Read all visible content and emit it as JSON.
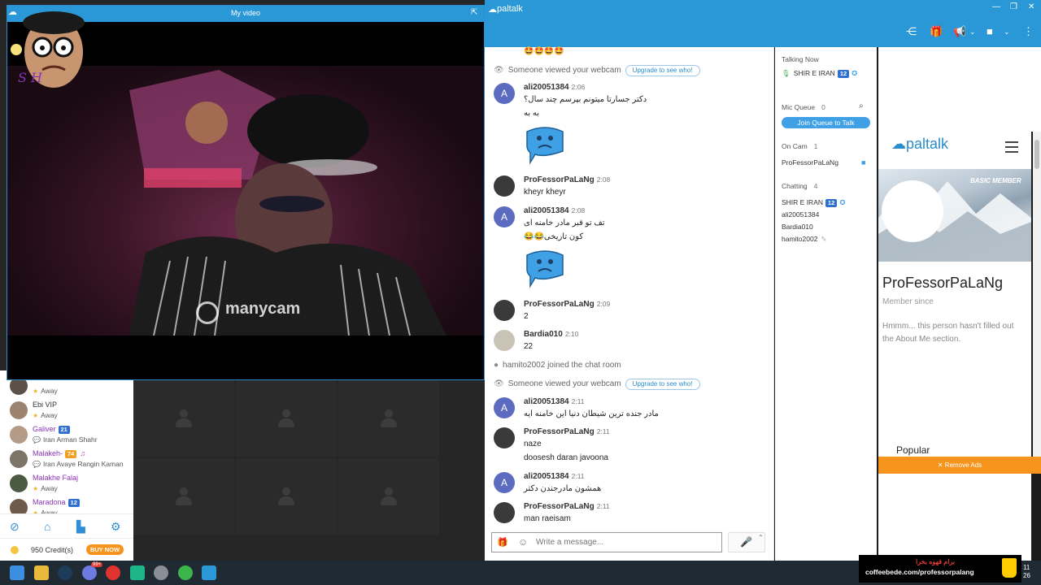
{
  "video_window": {
    "title": "My video",
    "overlay_logo": "manycam"
  },
  "app": {
    "name": "paltalk"
  },
  "friends": [
    {
      "name": "",
      "status": "Away",
      "status_kind": "away"
    },
    {
      "name": "Ebi VIP",
      "status": "Away",
      "status_kind": "away"
    },
    {
      "name": "Galiver",
      "badge": "21",
      "status": "Iran Arman Shahr",
      "status_kind": "room"
    },
    {
      "name": "Malakeh-",
      "badge": "74",
      "status": "Iran Avaye Rangin Kaman",
      "status_kind": "room"
    },
    {
      "name": "Malakhe Falaj",
      "status": "Away",
      "status_kind": "away"
    },
    {
      "name": "Maradona",
      "badge": "12",
      "status": "Away",
      "status_kind": "away"
    }
  ],
  "credits": {
    "text": "950 Credit(s)",
    "buy_label": "BUY NOW"
  },
  "chat": {
    "top_emojis": "🤩🤩🤩🤩",
    "upgrade_label": "Upgrade to see who!",
    "system_webcam": "Someone viewed your webcam",
    "system_join": "hamito2002 joined the chat room",
    "messages": [
      {
        "user": "ali20051384",
        "time": "2:06",
        "lines": [
          "دکتر جسارتا میتونم بپرسم چند سال؟",
          "به به"
        ]
      },
      {
        "user": "ProFessorPaLaNg",
        "time": "2:08",
        "lines": [
          "kheyr kheyr"
        ]
      },
      {
        "user": "ali20051384",
        "time": "2:08",
        "lines": [
          "تف تو قبر مادر خامنه ای",
          "کون تاریخی😂😂"
        ]
      },
      {
        "user": "ProFessorPaLaNg",
        "time": "2:09",
        "lines": [
          "2"
        ]
      },
      {
        "user": "Bardia010",
        "time": "2:10",
        "lines": [
          "22"
        ]
      },
      {
        "user": "ali20051384",
        "time": "2:11",
        "lines": [
          "مادر جنده ترین شیطان دنیا این خامنه ایه"
        ]
      },
      {
        "user": "ProFessorPaLaNg",
        "time": "2:11",
        "lines": [
          "naze",
          "doosesh daran javoona"
        ]
      },
      {
        "user": "ali20051384",
        "time": "2:11",
        "lines": [
          "همشون مادرجندن دکتر"
        ]
      },
      {
        "user": "ProFessorPaLaNg",
        "time": "2:11",
        "lines": [
          "man raeisam"
        ]
      }
    ],
    "composer_placeholder": "Write a message..."
  },
  "side_panel": {
    "talking_now_label": "Talking Now",
    "talking_user": "SHIR E IRAN",
    "talking_badge": "12",
    "mic_queue_label": "Mic Queue",
    "mic_queue_count": "0",
    "join_queue_label": "Join Queue to Talk",
    "on_cam_label": "On Cam",
    "on_cam_count": "1",
    "on_cam_user": "ProFessorPaLaNg",
    "chatting_label": "Chatting",
    "chatting_count": "4",
    "chatting_users": [
      {
        "name": "SHIR E IRAN",
        "badge": "12"
      },
      {
        "name": "ali20051384"
      },
      {
        "name": "Bardia010"
      },
      {
        "name": "hamito2002"
      }
    ]
  },
  "profile": {
    "logo": "paltalk",
    "member_type": "BASIC MEMBER",
    "name": "ProFessorPaLaNg",
    "member_since": "Member since",
    "about": "Hmmm... this person hasn't filled out the About Me section.",
    "popular_label": "Popular",
    "remove_ads": "✕ Remove Ads"
  },
  "coffee_banner": {
    "headline": "برام قهوه بخرا",
    "url": "coffeebede.com/professorpalang"
  },
  "taskbar": {
    "clock_top": "11",
    "clock_bottom": "26",
    "badge": "99+"
  },
  "colors": {
    "brand_blue": "#2a98d7",
    "accent_orange": "#f7941d",
    "avatar_indigo": "#5c6bc0"
  }
}
